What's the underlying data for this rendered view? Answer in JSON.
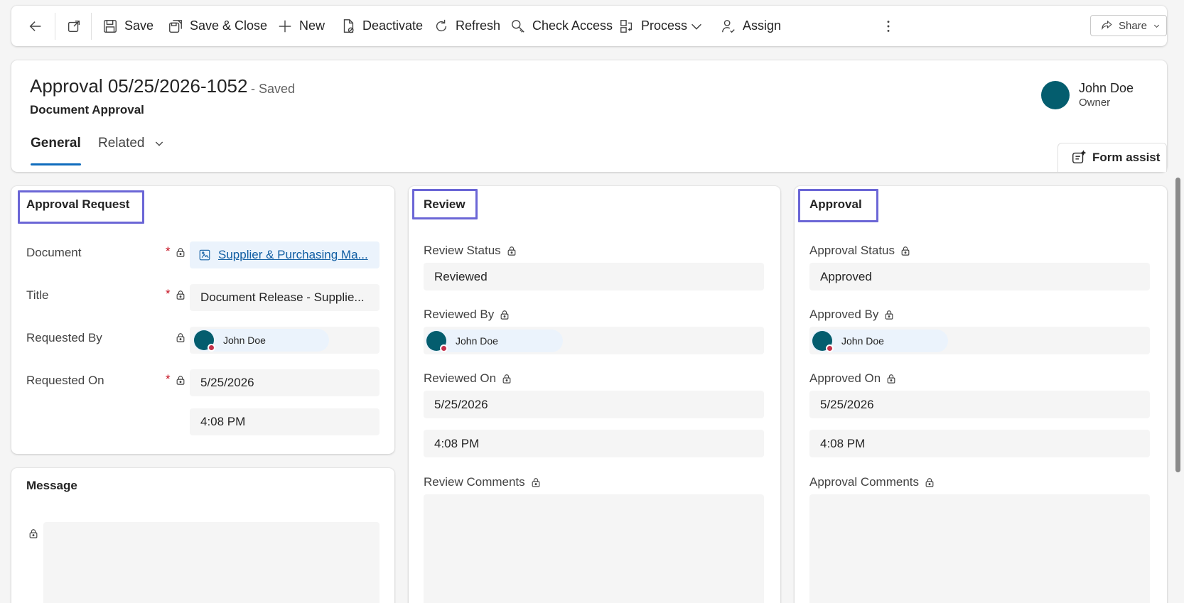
{
  "commandbar": {
    "back_icon": "back-arrow-icon",
    "popout_icon": "open-in-new-window-icon",
    "save": "Save",
    "save_close": "Save & Close",
    "new": "New",
    "deactivate": "Deactivate",
    "refresh": "Refresh",
    "check_access": "Check Access",
    "process": "Process",
    "assign": "Assign",
    "share": "Share"
  },
  "record": {
    "title": "Approval 05/25/2026-1052",
    "saved_status": "- Saved",
    "entity": "Document Approval",
    "owner_name": "John Doe",
    "owner_role": "Owner"
  },
  "tabs": {
    "general": "General",
    "related": "Related"
  },
  "form_assist": "Form assist",
  "approval_request": {
    "title": "Approval Request",
    "document_label": "Document",
    "document_value": "Supplier & Purchasing Ma...",
    "title_label": "Title",
    "title_value": "Document Release - Supplie...",
    "requested_by_label": "Requested By",
    "requested_by_value": "John Doe",
    "requested_on_label": "Requested On",
    "requested_on_date": "5/25/2026",
    "requested_on_time": "4:08 PM",
    "required_mark": "*"
  },
  "message": {
    "title": "Message"
  },
  "review": {
    "title": "Review",
    "status_label": "Review Status",
    "status_value": "Reviewed",
    "by_label": "Reviewed By",
    "by_value": "John Doe",
    "on_label": "Reviewed On",
    "on_date": "5/25/2026",
    "on_time": "4:08 PM",
    "comments_label": "Review Comments"
  },
  "approval": {
    "title": "Approval",
    "status_label": "Approval Status",
    "status_value": "Approved",
    "by_label": "Approved By",
    "by_value": "John Doe",
    "on_label": "Approved On",
    "on_date": "5/25/2026",
    "on_time": "4:08 PM",
    "comments_label": "Approval Comments"
  },
  "colors": {
    "accent": "#0f6cbd",
    "highlight_box": "#6b66d6",
    "avatar": "#045d6e",
    "required": "#c50f1f",
    "presence_busy": "#c4314b"
  }
}
